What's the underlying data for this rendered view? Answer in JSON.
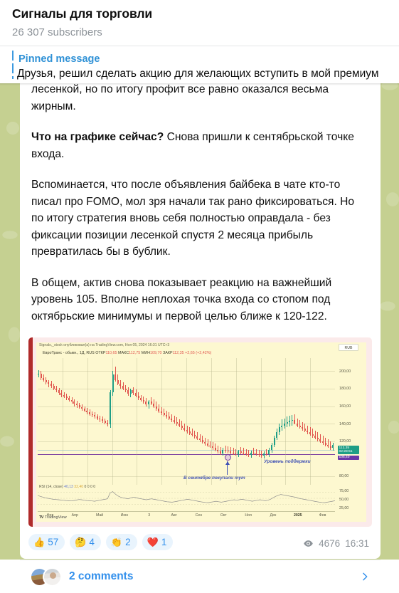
{
  "header": {
    "channel_title": "Сигналы для торговли",
    "subscribers": "26 307 subscribers"
  },
  "pinned": {
    "label": "Pinned message",
    "text": "Друзья, решил сделать акцию для желающих вступить в мой премиум"
  },
  "message": {
    "paragraph_cut": "лесенкой, но по итогу профит все равно оказался весьма жирным.",
    "p1_bold": "Что на графике сейчас?",
    "p1_rest": " Снова пришли к сентябрьской точке входа.",
    "p2": "Вспоминается, что после объявления байбека в чате кто-то писал про FOMO, мол зря начали так рано фиксироваться. Но по итогу стратегия вновь себя полностью оправдала - без фиксации позиции лесенкой спустя 2 месяца прибыль превратилась бы в бублик.",
    "p3": "В общем, актив снова показывает реакцию на важнейший уровень 105. Вполне неплохая точка входа со стопом под октябрьские минимумы и первой целью ближе к 120-122.",
    "views": "4676",
    "time": "16:31"
  },
  "reactions": [
    {
      "emoji": "👍",
      "count": "57",
      "name": "thumbs-up"
    },
    {
      "emoji": "🤔",
      "count": "4",
      "name": "thinking"
    },
    {
      "emoji": "👏",
      "count": "2",
      "name": "clap"
    },
    {
      "emoji": "❤️",
      "count": "1",
      "name": "heart"
    }
  ],
  "comments": {
    "label": "2 comments"
  },
  "chart_data": {
    "type": "line",
    "caption": "Signals,_stock опубликовал(а) на TradingView.com, Ноя 05, 2024 16:31 UTC+3",
    "ticker_symbol": "ЕвроТранс - обыкн., 1Д, RUS",
    "ticker_open_label": "ОТКР",
    "ticker_open": "110,65",
    "ticker_high_label": "МАКС",
    "ticker_high": "112,75",
    "ticker_low_label": "МИН",
    "ticker_low": "109,70",
    "ticker_close_label": "ЗАКР",
    "ticker_close": "112,35",
    "ticker_change": "+2,65 (+2,42%)",
    "currency": "RUB",
    "price_ticks": [
      "200,00",
      "180,00",
      "160,00",
      "140,00",
      "120,00",
      "80,00"
    ],
    "price_tick_values": [
      200,
      180,
      160,
      140,
      120,
      80
    ],
    "current_price_badge": "112,35",
    "current_price_timer": "02:28:51",
    "support_price_badge": "105,40",
    "rsi_ticks": [
      "75,00",
      "50,00",
      "25,00"
    ],
    "rsi_title": "RSI (14, close)",
    "rsi_value_1": "40,13",
    "rsi_value_2": "32,40",
    "rsi_zeros": "0  0  0  0",
    "x_ticks": [
      "Фев",
      "Апр",
      "Май",
      "Июн",
      "3",
      "Авг",
      "Сен",
      "Окт",
      "Ноя",
      "Дек",
      "2025",
      "Фев"
    ],
    "annotation_support": "Уровень поддержки",
    "annotation_buy": "В сентябре покупали тут",
    "watermark": "TradingView",
    "colors": {
      "up": "#1f9e86",
      "down": "#e0544d",
      "support": "#7b3fa0",
      "annotation": "#3f51b5",
      "plot_bg": "#fdf8d0",
      "frame": "#fbeaea"
    },
    "ylim": [
      70,
      215
    ],
    "support_level": 105.4,
    "series": [
      {
        "name": "ЕвроТранс daily candles (O,H,L,C)",
        "values": [
          [
            196,
            201,
            193,
            197
          ],
          [
            197,
            200,
            190,
            192
          ],
          [
            192,
            196,
            188,
            190
          ],
          [
            190,
            193,
            185,
            187
          ],
          [
            187,
            190,
            182,
            186
          ],
          [
            186,
            189,
            181,
            183
          ],
          [
            183,
            186,
            178,
            180
          ],
          [
            180,
            183,
            176,
            178
          ],
          [
            178,
            181,
            173,
            175
          ],
          [
            175,
            178,
            170,
            173
          ],
          [
            173,
            176,
            169,
            171
          ],
          [
            171,
            174,
            167,
            169
          ],
          [
            169,
            172,
            165,
            167
          ],
          [
            167,
            170,
            163,
            165
          ],
          [
            165,
            168,
            160,
            163
          ],
          [
            163,
            166,
            158,
            161
          ],
          [
            161,
            164,
            157,
            159
          ],
          [
            159,
            162,
            155,
            157
          ],
          [
            157,
            160,
            153,
            155
          ],
          [
            155,
            158,
            151,
            153
          ],
          [
            153,
            156,
            149,
            151
          ],
          [
            151,
            154,
            147,
            150
          ],
          [
            150,
            153,
            146,
            148
          ],
          [
            148,
            151,
            144,
            146
          ],
          [
            146,
            149,
            142,
            145
          ],
          [
            145,
            148,
            141,
            143
          ],
          [
            143,
            146,
            139,
            141
          ],
          [
            141,
            144,
            137,
            139
          ],
          [
            139,
            178,
            135,
            176
          ],
          [
            176,
            200,
            172,
            196
          ],
          [
            196,
            205,
            188,
            190
          ],
          [
            190,
            196,
            184,
            186
          ],
          [
            186,
            190,
            180,
            183
          ],
          [
            183,
            187,
            178,
            180
          ],
          [
            180,
            184,
            176,
            178
          ],
          [
            178,
            182,
            172,
            174
          ],
          [
            174,
            180,
            170,
            178
          ],
          [
            178,
            182,
            173,
            175
          ],
          [
            175,
            179,
            170,
            172
          ],
          [
            172,
            176,
            167,
            169
          ],
          [
            169,
            173,
            165,
            167
          ],
          [
            167,
            171,
            163,
            165
          ],
          [
            165,
            169,
            160,
            162
          ],
          [
            162,
            167,
            157,
            165
          ],
          [
            165,
            170,
            161,
            163
          ],
          [
            163,
            168,
            158,
            160
          ],
          [
            160,
            165,
            155,
            157
          ],
          [
            157,
            162,
            152,
            154
          ],
          [
            154,
            159,
            150,
            152
          ],
          [
            152,
            157,
            148,
            150
          ],
          [
            150,
            155,
            146,
            148
          ],
          [
            148,
            153,
            144,
            146
          ],
          [
            146,
            151,
            142,
            144
          ],
          [
            144,
            149,
            140,
            142
          ],
          [
            142,
            147,
            138,
            140
          ],
          [
            140,
            145,
            136,
            138
          ],
          [
            138,
            143,
            133,
            135
          ],
          [
            135,
            140,
            131,
            133
          ],
          [
            133,
            138,
            129,
            131
          ],
          [
            131,
            136,
            127,
            129
          ],
          [
            129,
            134,
            125,
            127
          ],
          [
            127,
            132,
            123,
            125
          ],
          [
            125,
            130,
            121,
            123
          ],
          [
            123,
            128,
            119,
            121
          ],
          [
            121,
            126,
            117,
            119
          ],
          [
            119,
            124,
            115,
            117
          ],
          [
            117,
            122,
            113,
            115
          ],
          [
            115,
            120,
            112,
            114
          ],
          [
            114,
            119,
            110,
            112
          ],
          [
            112,
            117,
            108,
            110
          ],
          [
            110,
            115,
            106,
            108
          ],
          [
            108,
            113,
            104,
            106
          ],
          [
            106,
            112,
            103,
            110
          ],
          [
            110,
            115,
            107,
            109
          ],
          [
            109,
            114,
            106,
            108
          ],
          [
            108,
            113,
            105,
            107
          ],
          [
            107,
            112,
            104,
            106
          ],
          [
            106,
            111,
            103,
            105
          ],
          [
            105,
            110,
            102,
            108
          ],
          [
            108,
            113,
            105,
            107
          ],
          [
            107,
            112,
            104,
            106
          ],
          [
            106,
            111,
            103,
            105
          ],
          [
            105,
            110,
            102,
            104
          ],
          [
            104,
            109,
            101,
            107
          ],
          [
            107,
            112,
            104,
            106
          ],
          [
            106,
            111,
            103,
            105
          ],
          [
            105,
            110,
            102,
            104
          ],
          [
            104,
            109,
            101,
            103
          ],
          [
            103,
            108,
            100,
            106
          ],
          [
            106,
            111,
            103,
            105
          ],
          [
            105,
            112,
            102,
            110
          ],
          [
            110,
            118,
            107,
            116
          ],
          [
            116,
            126,
            113,
            124
          ],
          [
            124,
            134,
            121,
            130
          ],
          [
            130,
            140,
            127,
            136
          ],
          [
            136,
            145,
            132,
            138
          ],
          [
            138,
            146,
            134,
            140
          ],
          [
            140,
            148,
            136,
            142
          ],
          [
            142,
            149,
            137,
            143
          ],
          [
            143,
            150,
            138,
            144
          ],
          [
            144,
            151,
            139,
            140
          ],
          [
            140,
            146,
            136,
            138
          ],
          [
            138,
            144,
            134,
            136
          ],
          [
            136,
            142,
            132,
            134
          ],
          [
            134,
            140,
            130,
            132
          ],
          [
            132,
            138,
            128,
            130
          ],
          [
            130,
            136,
            126,
            128
          ],
          [
            128,
            134,
            124,
            126
          ],
          [
            126,
            132,
            122,
            124
          ],
          [
            124,
            130,
            120,
            122
          ],
          [
            122,
            128,
            118,
            120
          ],
          [
            120,
            126,
            116,
            118
          ],
          [
            118,
            124,
            114,
            116
          ],
          [
            116,
            122,
            112,
            114
          ],
          [
            114,
            120,
            110,
            112
          ],
          [
            112,
            118,
            109,
            116
          ]
        ]
      },
      {
        "name": "RSI(14)",
        "values": [
          62,
          58,
          55,
          52,
          50,
          48,
          46,
          45,
          44,
          43,
          42,
          41,
          40,
          39,
          41,
          43,
          45,
          44,
          42,
          41,
          40,
          39,
          38,
          40,
          42,
          44,
          46,
          48,
          72,
          78,
          68,
          60,
          55,
          52,
          50,
          48,
          52,
          55,
          53,
          50,
          48,
          46,
          44,
          46,
          48,
          46,
          44,
          42,
          40,
          38,
          36,
          35,
          34,
          36,
          38,
          40,
          42,
          44,
          46,
          44,
          42,
          40,
          38,
          36,
          34,
          33,
          32,
          34,
          36,
          38,
          36,
          34,
          36,
          38,
          40,
          42,
          44,
          42,
          44,
          46,
          44,
          42,
          40,
          38,
          40,
          42,
          44,
          42,
          40,
          42,
          46,
          52,
          58,
          62,
          66,
          64,
          62,
          60,
          58,
          56,
          54,
          50,
          48,
          46,
          44,
          42,
          40,
          38,
          36,
          34,
          33,
          32,
          34,
          36,
          38,
          40
        ]
      }
    ]
  }
}
